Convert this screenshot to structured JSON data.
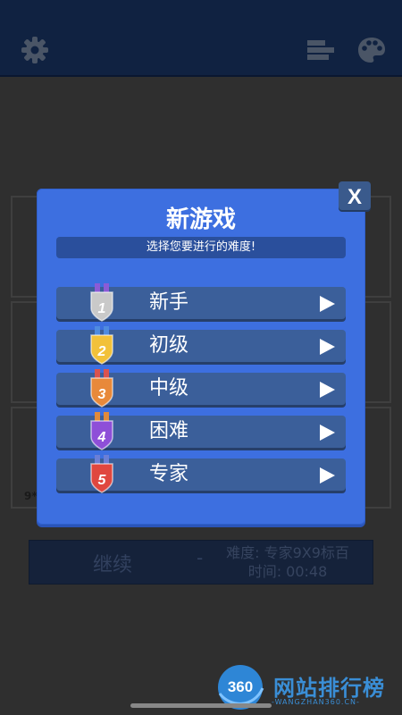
{
  "modal": {
    "title": "新游戏",
    "subtitle": "选择您要进行的难度!",
    "close_label": "X",
    "levels": [
      {
        "label": "新手",
        "medal_number": "1",
        "medal_color": "#c9c9c9",
        "ribbon_color": "#8b5bd6"
      },
      {
        "label": "初级",
        "medal_number": "2",
        "medal_color": "#f2c13a",
        "ribbon_color": "#4f8be0"
      },
      {
        "label": "中级",
        "medal_number": "3",
        "medal_color": "#e8893a",
        "ribbon_color": "#d9534f"
      },
      {
        "label": "困难",
        "medal_number": "4",
        "medal_color": "#8e4fd8",
        "ribbon_color": "#e08a3a"
      },
      {
        "label": "专家",
        "medal_number": "5",
        "medal_color": "#e0473f",
        "ribbon_color": "#6b7fd6"
      }
    ]
  },
  "background": {
    "board_label": "9*",
    "continue_label": "继续",
    "continue_dash": "-",
    "difficulty_info": "难度: 专家9X9标百",
    "time_info": "时间: 00:48"
  },
  "watermark": {
    "badge": "360",
    "text": "网站排行榜",
    "sub": "-WANGZHAN360.CN-"
  },
  "colors": {
    "modal_bg": "#3d6fe0",
    "button_bg": "#3b5f9a",
    "topbar_bg": "#102241"
  }
}
